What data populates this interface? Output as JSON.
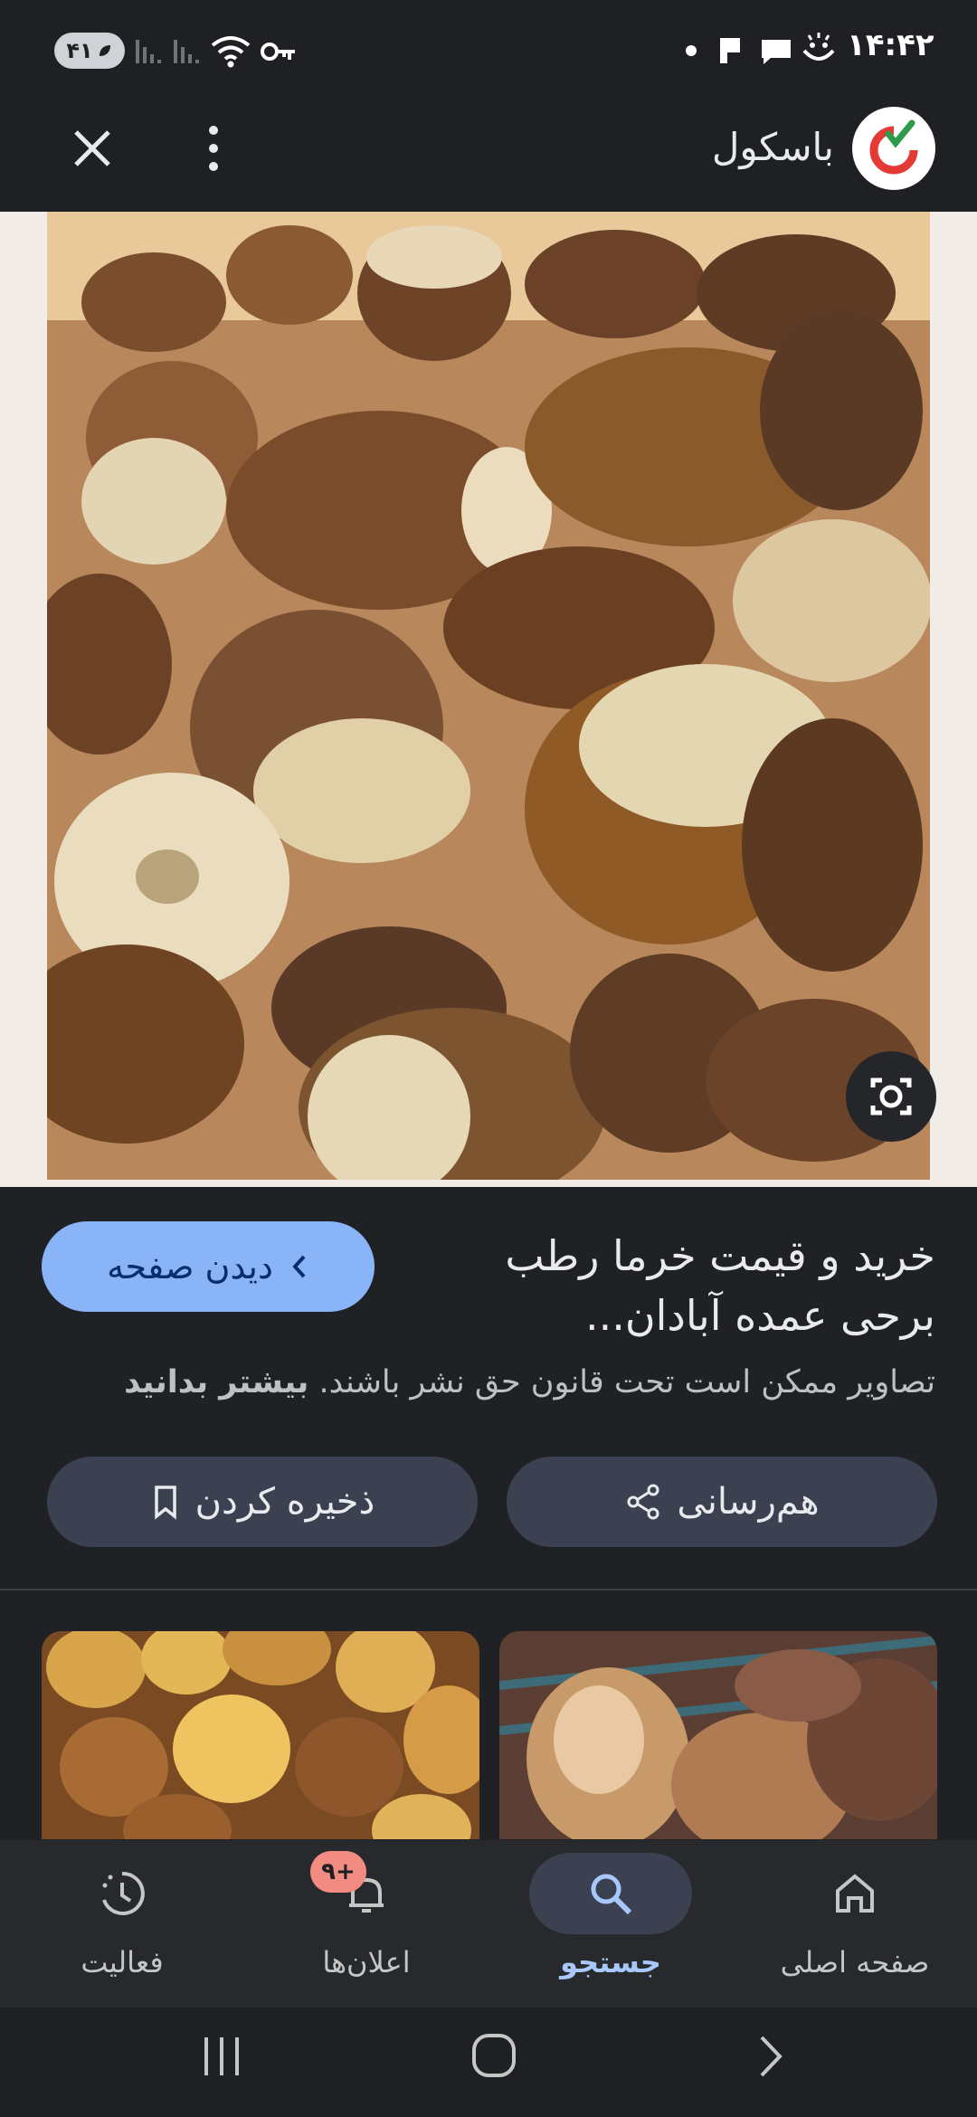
{
  "status_bar": {
    "time": "۱۴:۴۲",
    "battery": "۴۱"
  },
  "app_bar": {
    "site_name": "باسکول",
    "brand_color": "#e53935"
  },
  "result": {
    "title": "خرید و قیمت خرما رطب برحی عمده آبادان...",
    "visit_label": "دیدن صفحه",
    "notice_text": "تصاویر ممکن است تحت قانون حق نشر باشند.",
    "learn_more": "بیشتر بدانید",
    "share_label": "هم‌رسانی",
    "save_label": "ذخیره کردن"
  },
  "bottom_nav": {
    "items": [
      {
        "label": "صفحه اصلی",
        "icon": "home-icon",
        "active": false
      },
      {
        "label": "جستجو",
        "icon": "search-icon",
        "active": true
      },
      {
        "label": "اعلان‌ها",
        "icon": "bell-icon",
        "active": false,
        "badge": "۹+"
      },
      {
        "label": "فعالیت",
        "icon": "activity-icon",
        "active": false
      }
    ]
  },
  "colors": {
    "background": "#1f2024",
    "accent": "#8ab4f8",
    "chip": "#3c4151",
    "badge": "#f28b82"
  }
}
